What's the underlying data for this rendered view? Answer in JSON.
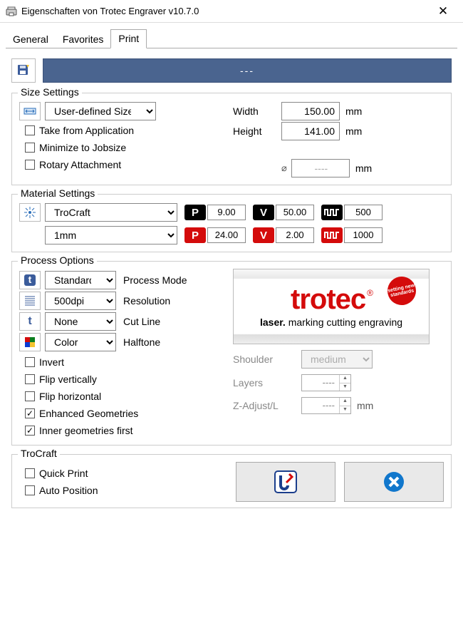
{
  "window": {
    "title": "Eigenschaften von Trotec Engraver v10.7.0"
  },
  "tabs": {
    "general": "General",
    "favorites": "Favorites",
    "print": "Print"
  },
  "header": {
    "bar_text": "---"
  },
  "size_settings": {
    "legend": "Size Settings",
    "select_value": "User-defined Size",
    "take_from_app": "Take from Application",
    "minimize": "Minimize to Jobsize",
    "rotary": "Rotary Attachment",
    "width_label": "Width",
    "height_label": "Height",
    "width": "150.00",
    "height": "141.00",
    "diameter": "----",
    "unit": "mm"
  },
  "material_settings": {
    "legend": "Material Settings",
    "material_value": "TroCraft",
    "thickness_value": "1mm",
    "row1": {
      "p": "9.00",
      "v": "50.00",
      "f": "500"
    },
    "row2": {
      "p": "24.00",
      "v": "2.00",
      "f": "1000"
    }
  },
  "process": {
    "legend": "Process Options",
    "mode": "Standard",
    "mode_label": "Process Mode",
    "resolution": "500dpi",
    "resolution_label": "Resolution",
    "cutline": "None",
    "cutline_label": "Cut Line",
    "halftone": "Color",
    "halftone_label": "Halftone",
    "invert": "Invert",
    "flip_v": "Flip vertically",
    "flip_h": "Flip horizontal",
    "enh_geo": "Enhanced Geometries",
    "inner_first": "Inner geometries first",
    "shoulder_label": "Shoulder",
    "shoulder": "medium",
    "layers_label": "Layers",
    "layers": "----",
    "zadjust_label": "Z-Adjust/L",
    "zadjust": "----",
    "logo_main": "trotec",
    "logo_sub_bold": "laser.",
    "logo_sub_rest": " marking cutting engraving",
    "logo_stamp": "setting new standards"
  },
  "footer": {
    "legend": "TroCraft",
    "quick_print": "Quick Print",
    "auto_position": "Auto Position"
  }
}
